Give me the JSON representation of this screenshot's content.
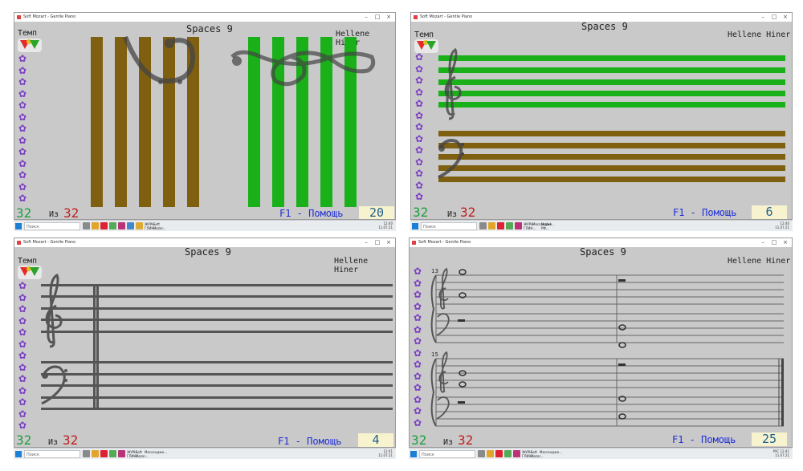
{
  "window_title": "Soft Mozart - Gentle Piano",
  "song_title": "Spaces 9",
  "author": "Hellene Hiner",
  "tempo_label": "Темп",
  "of_label": "Из",
  "total_count": "32",
  "help_label": "F1 - Помощь",
  "search_placeholder": "Поиск",
  "icons": {
    "flower": "purple-flower-icon",
    "tempo": "tempo-dial-icon",
    "start": "windows-start-icon"
  },
  "colors": {
    "brown": "#7f5f10",
    "green": "#19b019",
    "background": "#c9c9c9",
    "count_green": "#1e9e3e",
    "count_red": "#c01e1e",
    "help_blue": "#1f2fd6"
  },
  "panels": [
    {
      "id": "p1",
      "left_count": "32",
      "score": "20",
      "tray_time": "12:40",
      "tray_date": "11.07.21"
    },
    {
      "id": "p2",
      "left_count": "32",
      "score": "6",
      "tray_time": "12:40",
      "tray_date": "11.07.21"
    },
    {
      "id": "p3",
      "left_count": "32",
      "score": "4",
      "tray_time": "12:41",
      "tray_date": "11.07.21"
    },
    {
      "id": "p4",
      "left_count": "32",
      "score": "25",
      "tray_time": "12:41",
      "tray_date": "11.07.21",
      "measure_numbers": [
        "13",
        "15"
      ]
    }
  ],
  "taskbar_apps": [
    "ЖУРН. ГЛИН...",
    "Soft Mozar...",
    "Мессендже...",
    "Model РФ...",
    "Soft Mozar..."
  ],
  "tray_lang": "РУС"
}
